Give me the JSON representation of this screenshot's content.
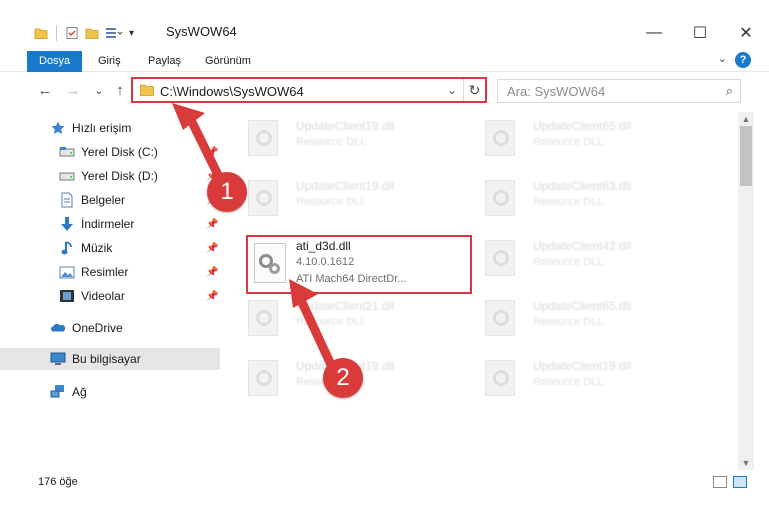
{
  "window": {
    "title": "SysWOW64",
    "minimize": "—",
    "maximize": "☐",
    "close": "✕"
  },
  "ribbon": {
    "tabs": [
      "Dosya",
      "Giriş",
      "Paylaş",
      "Görünüm"
    ],
    "help": "?",
    "expand": "⌄"
  },
  "address": {
    "path": "C:\\Windows\\SysWOW64",
    "dropdown": "⌄",
    "refresh": "↻"
  },
  "search": {
    "placeholder": "Ara: SysWOW64",
    "icon": "⌕"
  },
  "nav": {
    "back": "←",
    "forward": "→",
    "recent": "⌄",
    "up": "↑"
  },
  "sidebar": {
    "items": [
      {
        "label": "Hızlı erişim",
        "icon": "star-icon"
      },
      {
        "label": "Yerel Disk (C:)",
        "icon": "drive-icon",
        "pinned": true
      },
      {
        "label": "Yerel Disk (D:)",
        "icon": "drive-icon",
        "pinned": true
      },
      {
        "label": "Belgeler",
        "icon": "documents-icon",
        "pinned": true
      },
      {
        "label": "İndirmeler",
        "icon": "download-icon",
        "pinned": true
      },
      {
        "label": "Müzik",
        "icon": "music-icon",
        "pinned": true
      },
      {
        "label": "Resimler",
        "icon": "pictures-icon",
        "pinned": true
      },
      {
        "label": "Videolar",
        "icon": "videos-icon",
        "pinned": true
      },
      {
        "label": "OneDrive",
        "icon": "cloud-icon"
      },
      {
        "label": "Bu bilgisayar",
        "icon": "computer-icon",
        "selected": true
      },
      {
        "label": "Ağ",
        "icon": "network-icon"
      }
    ]
  },
  "files": {
    "left_col": [
      {
        "name": "UpdateClient19.dll",
        "sub": "Resource DLL"
      },
      {
        "name": "UpdateClient19.dll",
        "sub": "Resource DLL"
      },
      {
        "name": "UpdateClient21.dll",
        "sub": "Resource DLL"
      },
      {
        "name": "UpdateClient19.dll",
        "sub": "Resource DLL"
      }
    ],
    "right_col": [
      {
        "name": "UpdateClient65.dll",
        "sub": "Resource DLL"
      },
      {
        "name": "UpdateClient63.dll",
        "sub": "Resource DLL"
      },
      {
        "name": "UpdateClient42.dll",
        "sub": "Resource DLL"
      },
      {
        "name": "UpdateClient65.dll",
        "sub": "Resource DLL"
      },
      {
        "name": "UpdateClient19.dll",
        "sub": "Resource DLL"
      }
    ],
    "highlighted": {
      "name": "ati_d3d.dll",
      "version": "4.10.0.1612",
      "description": "ATI Mach64 DirectDr..."
    }
  },
  "status": {
    "count": "176 öğe"
  },
  "callouts": [
    "1",
    "2"
  ],
  "colors": {
    "accent": "#1979ca",
    "highlight_red": "#d9363e",
    "badge_red": "#d93a3a"
  }
}
